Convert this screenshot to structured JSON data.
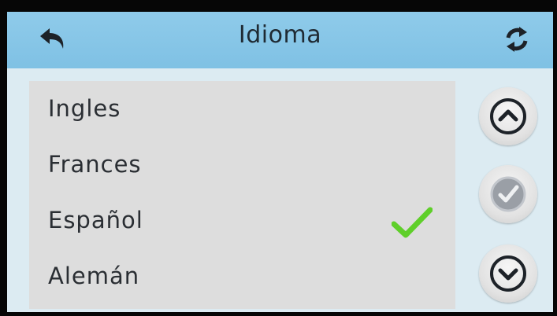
{
  "header": {
    "title": "Idioma",
    "back_icon": "back-arrow-icon",
    "refresh_icon": "refresh-icon"
  },
  "languages": [
    {
      "label": "Ingles",
      "selected": false
    },
    {
      "label": "Frances",
      "selected": false
    },
    {
      "label": "Español",
      "selected": true
    },
    {
      "label": "Alemán",
      "selected": false
    }
  ],
  "controls": {
    "up_icon": "chevron-up-icon",
    "confirm_icon": "check-circle-icon",
    "down_icon": "chevron-down-icon"
  },
  "colors": {
    "header": "#86c6e7",
    "screen_bg": "#dcebf2",
    "list_bg": "#dddddd",
    "check": "#5fcf2a",
    "text": "#2a2e33"
  }
}
